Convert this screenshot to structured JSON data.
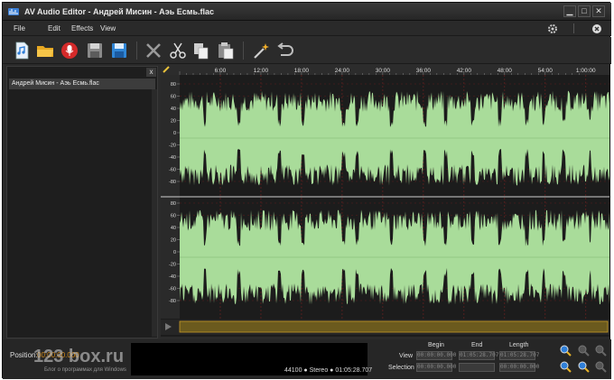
{
  "window": {
    "title": "AV Audio Editor - Андрей Мисин - Аэь Есмь.flac",
    "min_label": "▁",
    "max_label": "□",
    "close_label": "✕"
  },
  "menu": {
    "items": [
      "File",
      "Edit",
      "Effects",
      "View"
    ]
  },
  "toolbar": {
    "icons": [
      "new-file-icon",
      "open-folder-icon",
      "record-icon",
      "save-icon",
      "save-as-icon",
      "delete-icon",
      "cut-icon",
      "copy-icon",
      "paste-icon",
      "effects-wand-icon",
      "undo-icon"
    ]
  },
  "file_panel": {
    "close_label": "x",
    "files": [
      "Андрей Мисин - Аэь Есмь.flac"
    ]
  },
  "timeline": {
    "ticks": [
      "6:00",
      "12:00",
      "18:00",
      "24:00",
      "30:00",
      "36:00",
      "42:00",
      "48:00",
      "54:00",
      "1:00:00"
    ]
  },
  "amplitude_scale": [
    "80",
    "60",
    "40",
    "20",
    "0",
    "-20",
    "-40",
    "-60",
    "-80"
  ],
  "bottom": {
    "position_label": "Position:",
    "position_value": "00:00:00.000",
    "watermark": "123 box.ru",
    "watermark_sub": "Блог о программах для Windows",
    "info": "44100 ● Stereo ● 01:05:28.707"
  },
  "time_panel": {
    "headers": [
      "Begin",
      "End",
      "Length"
    ],
    "rows": [
      {
        "label": "View",
        "begin": "00:00:00.000",
        "end": "01:05:28.707",
        "length": "01:05:28.707"
      },
      {
        "label": "Selection",
        "begin": "00:00:00.000",
        "end": "",
        "length": "00:00:00.000"
      }
    ]
  },
  "colors": {
    "waveform": "#a9dc9a",
    "background": "#2b2b2b",
    "accent_orange": "#d28a1a"
  }
}
